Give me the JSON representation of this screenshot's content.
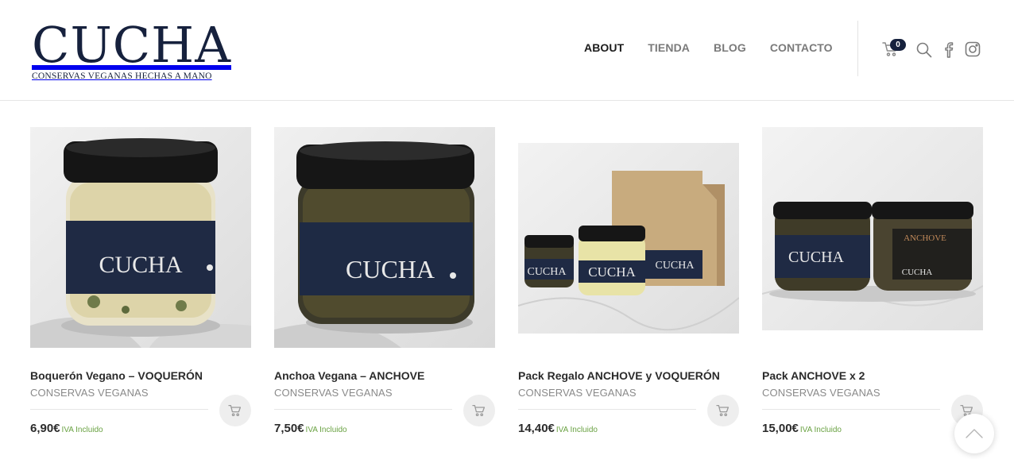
{
  "brand": {
    "name": "CUCHA",
    "tagline": "CONSERVAS VEGANAS HECHAS A MANO",
    "color": "#16213d"
  },
  "nav": {
    "items": [
      {
        "label": "ABOUT",
        "active": true
      },
      {
        "label": "TIENDA",
        "active": false
      },
      {
        "label": "BLOG",
        "active": false
      },
      {
        "label": "CONTACTO",
        "active": false
      }
    ]
  },
  "header_icons": {
    "cart": {
      "icon": "cart-icon",
      "count": "0"
    },
    "search": {
      "icon": "search-icon"
    },
    "facebook": {
      "icon": "facebook-icon"
    },
    "instagram": {
      "icon": "instagram-icon"
    }
  },
  "products": [
    {
      "title": "Boquerón Vegano – VOQUERÓN",
      "category": "CONSERVAS VEGANAS",
      "price": "6,90€",
      "tax": "IVA Incluido",
      "label_text": "CUCHA"
    },
    {
      "title": "Anchoa Vegana – ANCHOVE",
      "category": "CONSERVAS VEGANAS",
      "price": "7,50€",
      "tax": "IVA Incluido",
      "label_text": "CUCHA"
    },
    {
      "title": "Pack Regalo ANCHOVE y VOQUERÓN",
      "category": "CONSERVAS VEGANAS",
      "price": "14,40€",
      "tax": "IVA Incluido",
      "label_text": "CUCHA"
    },
    {
      "title": "Pack ANCHOVE x 2",
      "category": "CONSERVAS VEGANAS",
      "price": "15,00€",
      "tax": "IVA Incluido",
      "label_text": "CUCHA",
      "label_text_2": "ANCHOVE"
    }
  ],
  "colors": {
    "accent_green": "#6aa243",
    "text_dark": "#2b2b2b",
    "text_muted": "#8a8a8a"
  }
}
